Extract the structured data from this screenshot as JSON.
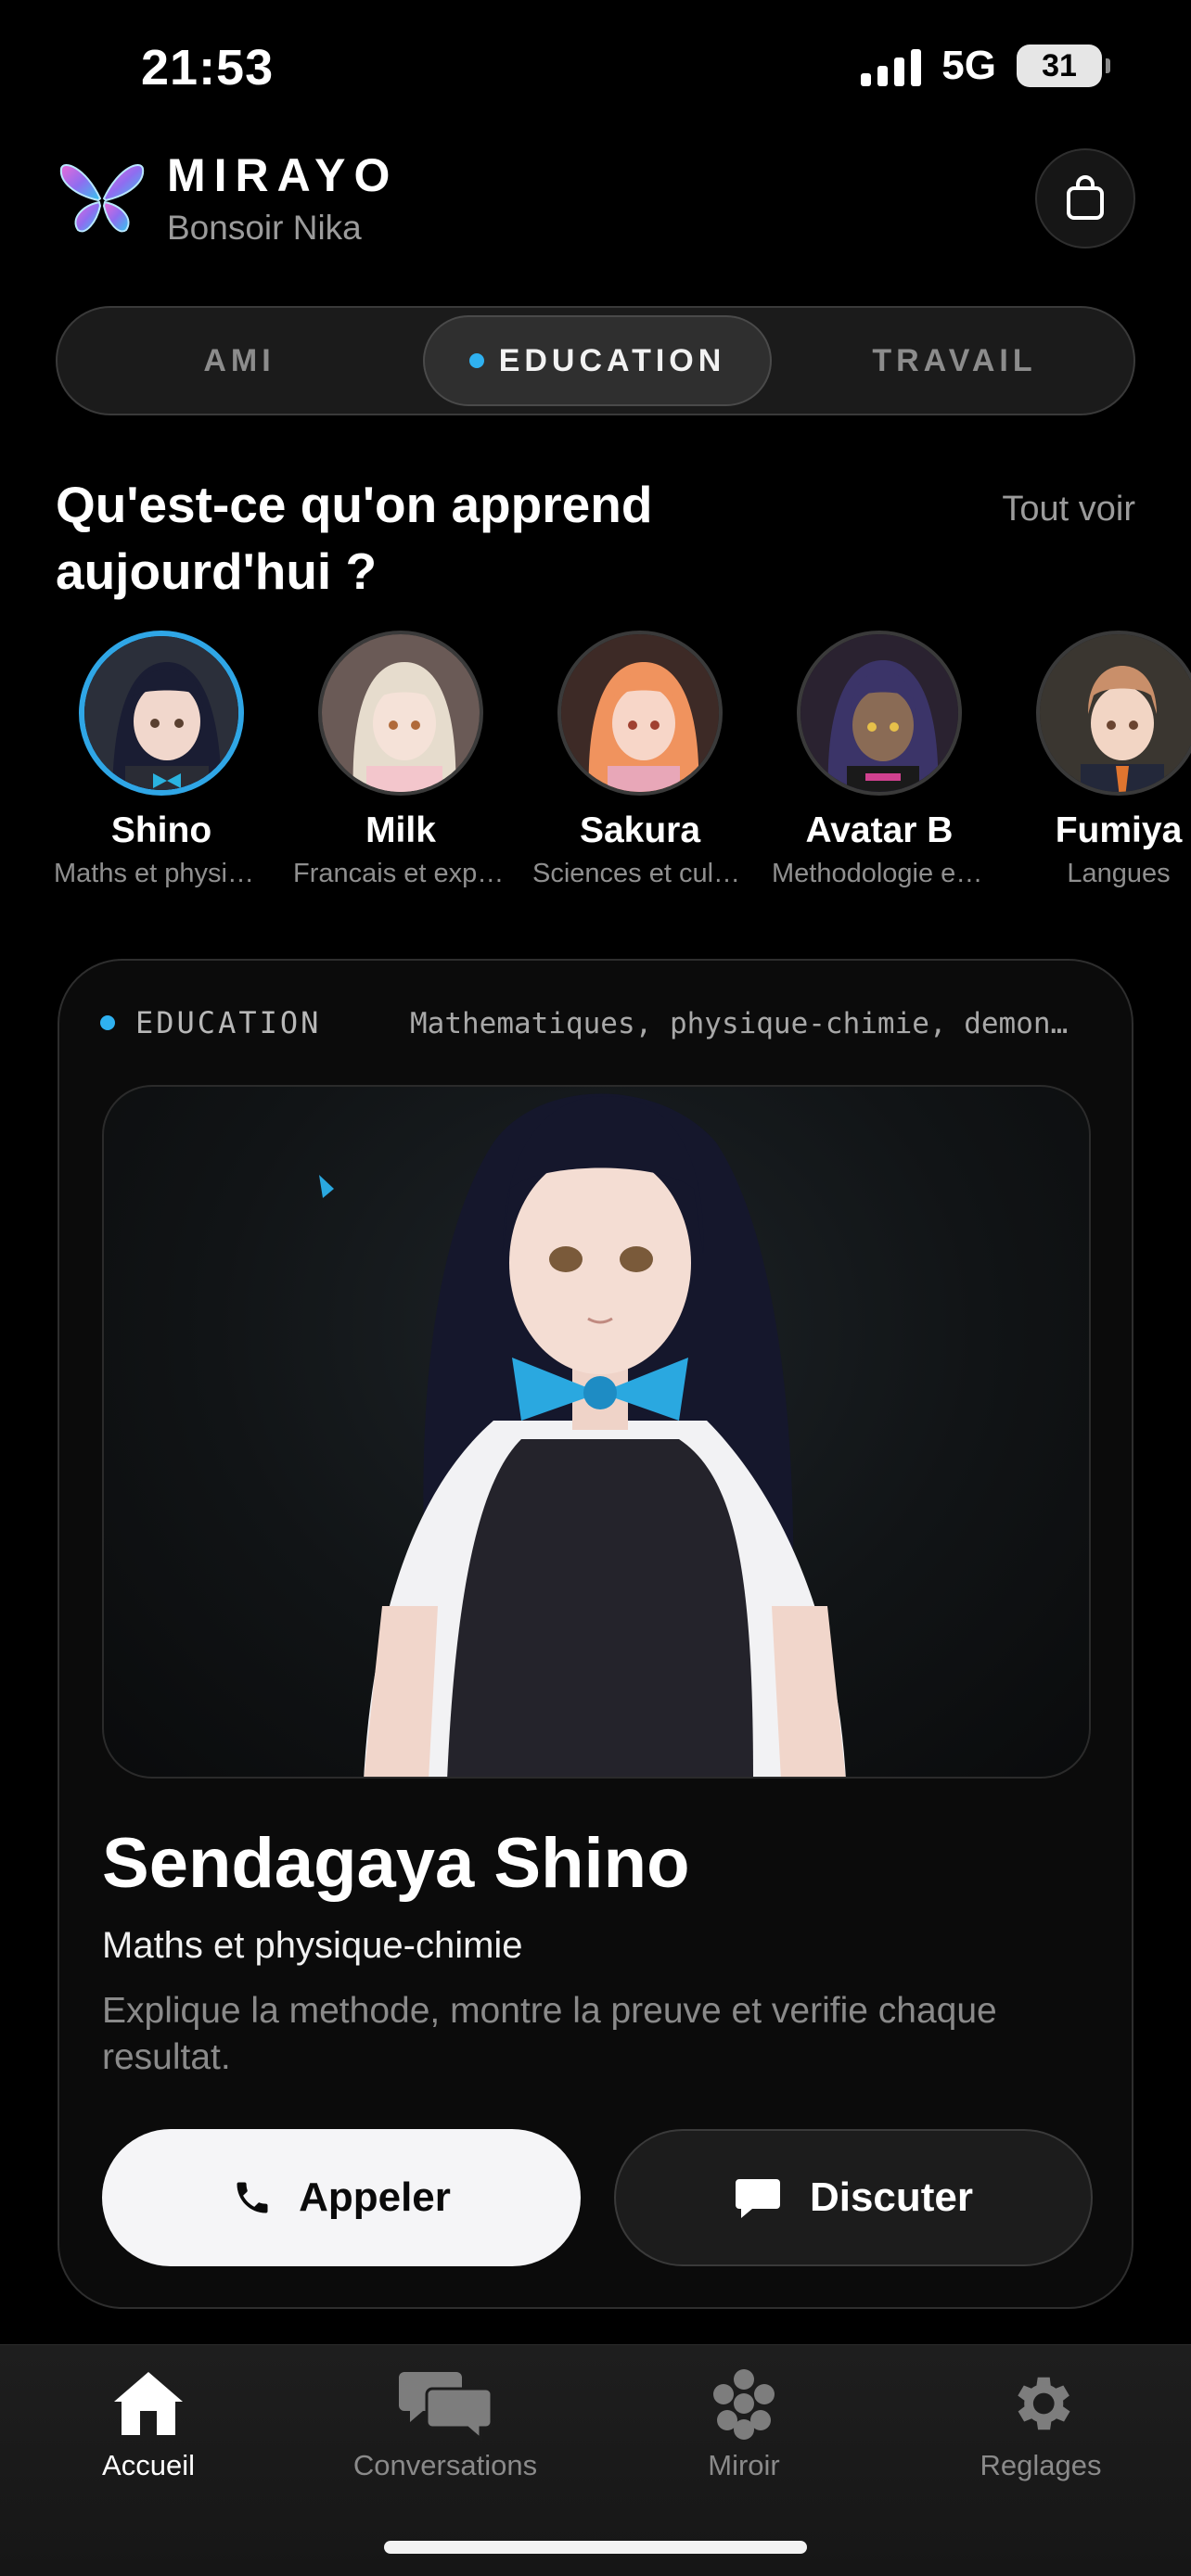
{
  "status_bar": {
    "time": "21:53",
    "network": "5G",
    "battery": "31"
  },
  "header": {
    "brand": "MIRAYO",
    "greeting": "Bonsoir Nika"
  },
  "mode_tabs": [
    {
      "label": "AMI",
      "active": false
    },
    {
      "label": "EDUCATION",
      "active": true
    },
    {
      "label": "TRAVAIL",
      "active": false
    }
  ],
  "section": {
    "title": "Qu'est-ce qu'on apprend aujourd'hui ?",
    "see_all": "Tout voir"
  },
  "avatars": [
    {
      "name": "Shino",
      "subtitle": "Maths et physique-chimie",
      "selected": true
    },
    {
      "name": "Milk",
      "subtitle": "Francais et expression",
      "selected": false
    },
    {
      "name": "Sakura",
      "subtitle": "Sciences et culture",
      "selected": false
    },
    {
      "name": "Avatar B",
      "subtitle": "Methodologie et organisation",
      "selected": false
    },
    {
      "name": "Fumiya",
      "subtitle": "Langues",
      "selected": false
    }
  ],
  "featured": {
    "tag": "EDUCATION",
    "subject_line": "Mathematiques, physique-chimie, demonstrations",
    "name": "Sendagaya Shino",
    "subject": "Maths et physique-chimie",
    "description": "Explique la methode, montre la preuve et verifie chaque resultat.",
    "call_label": "Appeler",
    "chat_label": "Discuter"
  },
  "bottom_nav": [
    {
      "label": "Accueil",
      "icon": "home-icon",
      "active": true
    },
    {
      "label": "Conversations",
      "icon": "chat-bubbles-icon",
      "active": false
    },
    {
      "label": "Miroir",
      "icon": "flower-dots-icon",
      "active": false
    },
    {
      "label": "Reglages",
      "icon": "gear-icon",
      "active": false
    }
  ],
  "colors": {
    "accent": "#2fb1f0",
    "background": "#000000",
    "card": "#0b0b0b"
  }
}
